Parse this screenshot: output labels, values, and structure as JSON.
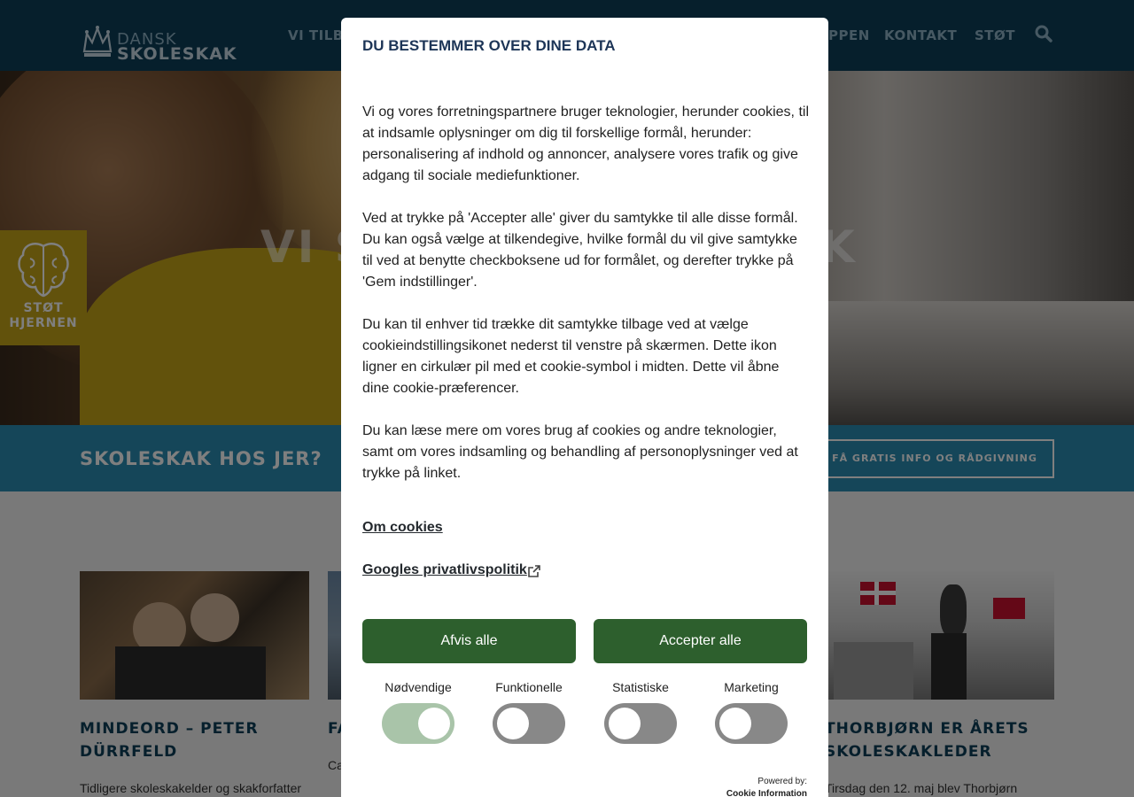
{
  "header": {
    "logo_small": "DANSK",
    "logo_big": "SKOLESKAK",
    "nav": [
      "VI TILBYDER",
      "PPEN",
      "KONTAKT",
      "STØT"
    ]
  },
  "hero": {
    "title_left": "VI S",
    "title_right": "K",
    "badge_line1": "STØT",
    "badge_line2": "HJERNEN"
  },
  "band": {
    "title": "SKOLESKAK HOS JER?",
    "button": "FÅ GRATIS INFO OG RÅDGIVNING"
  },
  "news": [
    {
      "title": "MINDEORD – PETER DÜRRFELD",
      "text": "Tidligere skoleskakelder og skakforfatter"
    },
    {
      "title": "FA",
      "text": "Ca"
    },
    {
      "title": "THORBJØRN ER ÅRETS SKOLESKAKLEDER",
      "text": "Tirsdag den 12. maj blev Thorbjørn"
    }
  ],
  "consent": {
    "title": "DU BESTEMMER OVER DINE DATA",
    "paragraphs": [
      "Vi og vores forretningspartnere bruger teknologier, herunder cookies, til at indsamle oplysninger om dig til forskellige formål, herunder: personalisering af indhold og annoncer, analysere vores trafik og give adgang til sociale mediefunktioner.",
      "Ved at trykke på 'Accepter alle' giver du samtykke til alle disse formål. Du kan også vælge at tilkendegive, hvilke formål du vil give samtykke til ved at benytte checkboksene ud for formålet, og derefter trykke på 'Gem indstillinger'.",
      "Du kan til enhver tid trække dit samtykke tilbage ved at vælge cookieindstillingsikonet nederst til venstre på skærmen. Dette ikon ligner en cirkulær pil med et cookie-symbol i midten. Dette vil åbne dine cookie-præferencer.",
      "Du kan læse mere om vores brug af cookies og andre teknologier, samt om vores indsamling og behandling af personoplysninger ved at trykke på linket."
    ],
    "link_cookies": "Om cookies",
    "link_google": "Googles privatlivspolitik",
    "reject_label": "Afvis alle",
    "accept_label": "Accepter alle",
    "toggles": [
      {
        "label": "Nødvendige",
        "on": true
      },
      {
        "label": "Funktionelle",
        "on": false
      },
      {
        "label": "Statistiske",
        "on": false
      },
      {
        "label": "Marketing",
        "on": false
      }
    ],
    "powered_by": "Powered by:",
    "powered_brand": "Cookie Information"
  },
  "colors": {
    "header_bg": "#0d3f59",
    "band_bg": "#2a8cb3",
    "badge_bg": "#c4a419",
    "button_green": "#2d5f2d",
    "toggle_on": "#a9c4a9",
    "toggle_off": "#888888"
  }
}
